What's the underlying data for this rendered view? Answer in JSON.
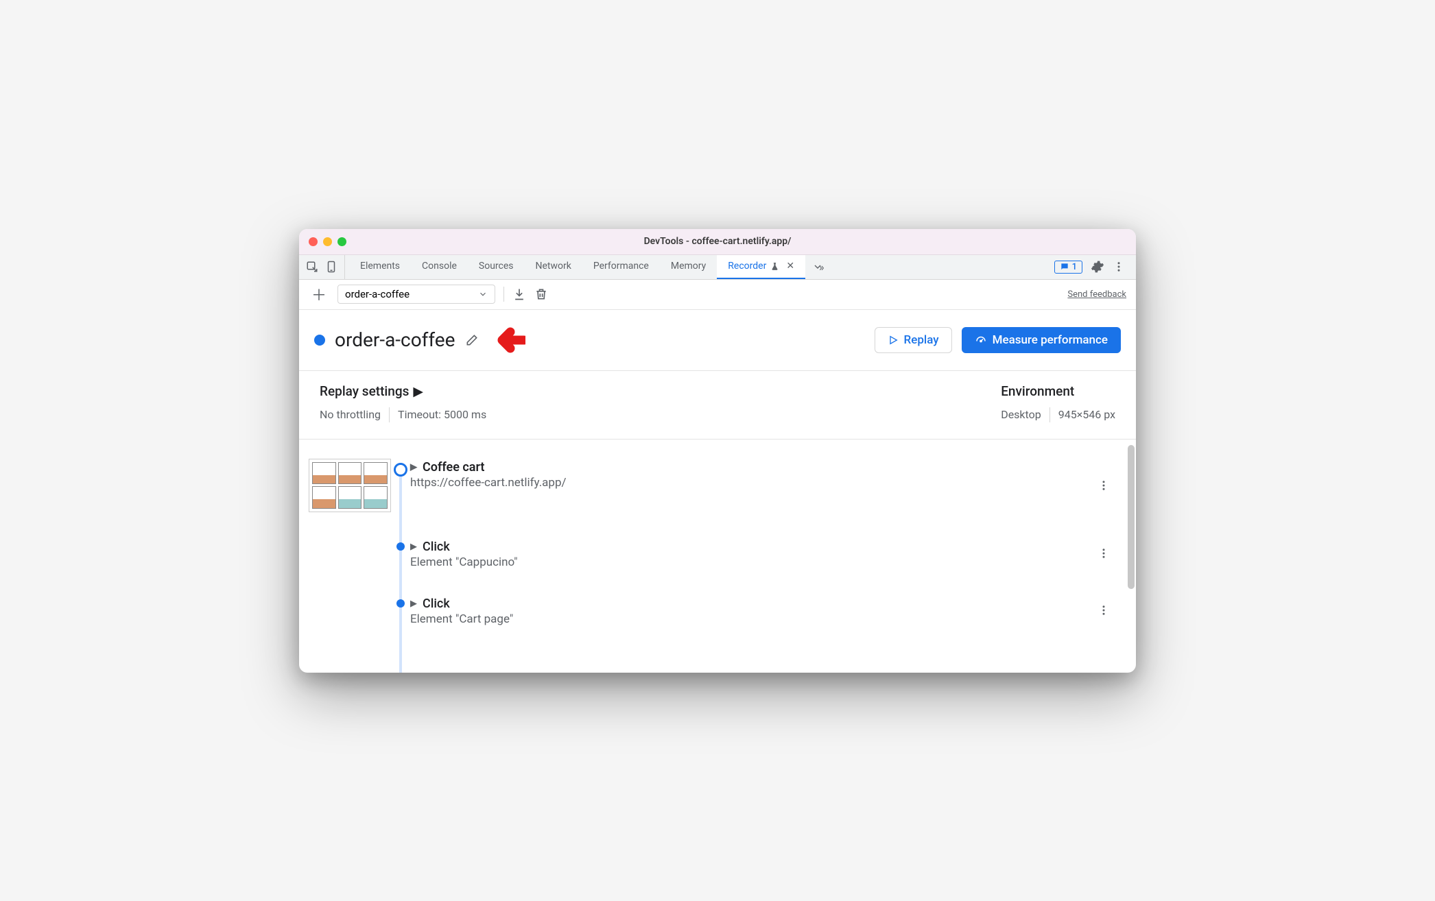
{
  "window": {
    "title": "DevTools - coffee-cart.netlify.app/"
  },
  "tabs": {
    "items": [
      "Elements",
      "Console",
      "Sources",
      "Network",
      "Performance",
      "Memory"
    ],
    "active": "Recorder",
    "badge_count": "1"
  },
  "toolbar": {
    "recording_name": "order-a-coffee",
    "send_feedback": "Send feedback"
  },
  "header": {
    "title": "order-a-coffee",
    "replay_label": "Replay",
    "measure_label": "Measure performance"
  },
  "settings": {
    "replay_heading": "Replay settings",
    "throttling": "No throttling",
    "timeout": "Timeout: 5000 ms",
    "env_heading": "Environment",
    "device": "Desktop",
    "viewport": "945×546 px"
  },
  "steps": [
    {
      "title": "Coffee cart",
      "sub": "https://coffee-cart.netlify.app/",
      "bold": true,
      "thumb": true
    },
    {
      "title": "Click",
      "sub": "Element \"Cappucino\"",
      "bold": false,
      "thumb": false
    },
    {
      "title": "Click",
      "sub": "Element \"Cart page\"",
      "bold": false,
      "thumb": false
    }
  ]
}
